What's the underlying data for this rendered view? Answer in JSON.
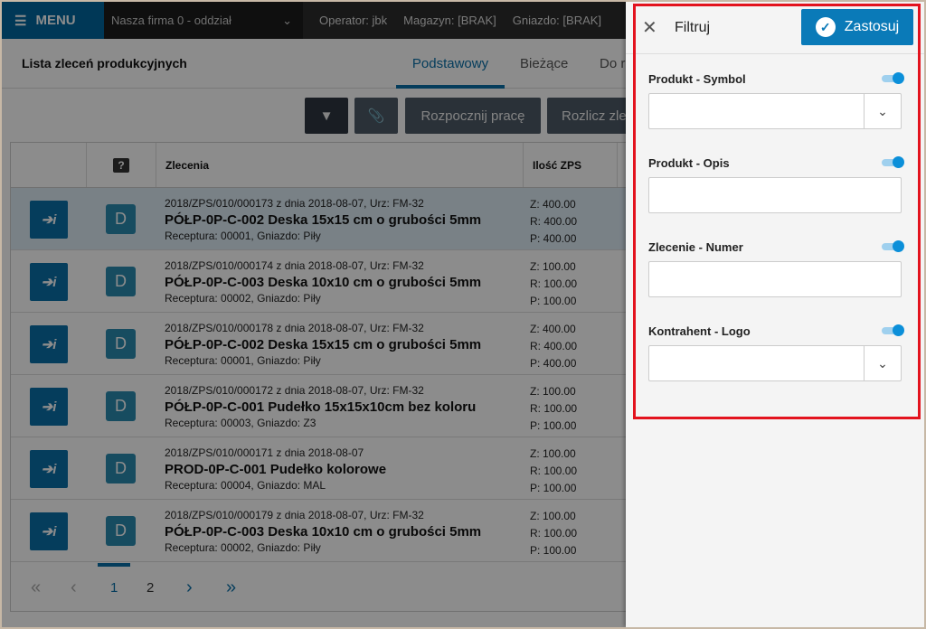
{
  "topbar": {
    "menu": "MENU",
    "firm": "Nasza firma 0 - oddział",
    "operator": "Operator: jbk",
    "magazyn": "Magazyn: [BRAK]",
    "gniazdo": "Gniazdo: [BRAK]"
  },
  "page": {
    "title": "Lista zleceń produkcyjnych",
    "tabs": [
      "Podstawowy",
      "Bieżące",
      "Do r"
    ]
  },
  "toolbar": {
    "start": "Rozpocznij pracę",
    "settle": "Rozlicz zle"
  },
  "table": {
    "headers": {
      "help": "?",
      "orders": "Zlecenia",
      "qty": "Ilość ZPS"
    },
    "rows": [
      {
        "ref": "2018/ZPS/010/000173 z dnia 2018-08-07, Urz: FM-32",
        "name": "PÓŁP-0P-C-002 Deska 15x15 cm o grubości 5mm",
        "sub": "Receptura: 00001, Gniazdo: Piły",
        "z": "Z: 400.00",
        "r": "R: 400.00",
        "p": "P: 400.00",
        "badge": "D"
      },
      {
        "ref": "2018/ZPS/010/000174 z dnia 2018-08-07, Urz: FM-32",
        "name": "PÓŁP-0P-C-003 Deska 10x10 cm o grubości 5mm",
        "sub": "Receptura: 00002, Gniazdo: Piły",
        "z": "Z: 100.00",
        "r": "R: 100.00",
        "p": "P: 100.00",
        "badge": "D"
      },
      {
        "ref": "2018/ZPS/010/000178 z dnia 2018-08-07, Urz: FM-32",
        "name": "PÓŁP-0P-C-002 Deska 15x15 cm o grubości 5mm",
        "sub": "Receptura: 00001, Gniazdo: Piły",
        "z": "Z: 400.00",
        "r": "R: 400.00",
        "p": "P: 400.00",
        "badge": "D"
      },
      {
        "ref": "2018/ZPS/010/000172 z dnia 2018-08-07, Urz: FM-32",
        "name": "PÓŁP-0P-C-001 Pudełko 15x15x10cm bez koloru",
        "sub": "Receptura: 00003, Gniazdo: Z3",
        "z": "Z: 100.00",
        "r": "R: 100.00",
        "p": "P: 100.00",
        "badge": "D"
      },
      {
        "ref": "2018/ZPS/010/000171 z dnia 2018-08-07",
        "name": "PROD-0P-C-001 Pudełko kolorowe",
        "sub": "Receptura: 00004, Gniazdo: MAL",
        "z": "Z: 100.00",
        "r": "R: 100.00",
        "p": "P: 100.00",
        "badge": "D"
      },
      {
        "ref": "2018/ZPS/010/000179 z dnia 2018-08-07, Urz: FM-32",
        "name": "PÓŁP-0P-C-003 Deska 10x10 cm o grubości 5mm",
        "sub": "Receptura: 00002, Gniazdo: Piły",
        "z": "Z: 100.00",
        "r": "R: 100.00",
        "p": "P: 100.00",
        "badge": "D"
      }
    ]
  },
  "pager": {
    "first": "«",
    "prev": "‹",
    "pages": [
      "1",
      "2"
    ],
    "next": "›",
    "last": "»",
    "current": "1"
  },
  "filter": {
    "close": "✕",
    "title": "Filtruj",
    "apply": "Zastosuj",
    "fields": [
      {
        "label": "Produkt - Symbol",
        "type": "dropdown",
        "enabled": true,
        "value": ""
      },
      {
        "label": "Produkt - Opis",
        "type": "text",
        "enabled": true,
        "value": ""
      },
      {
        "label": "Zlecenie - Numer",
        "type": "text",
        "enabled": true,
        "value": ""
      },
      {
        "label": "Kontrahent - Logo",
        "type": "dropdown",
        "enabled": true,
        "value": ""
      }
    ]
  },
  "colors": {
    "accent": "#0a7ab8",
    "menu": "#00669e",
    "highlight": "#e3131e"
  }
}
